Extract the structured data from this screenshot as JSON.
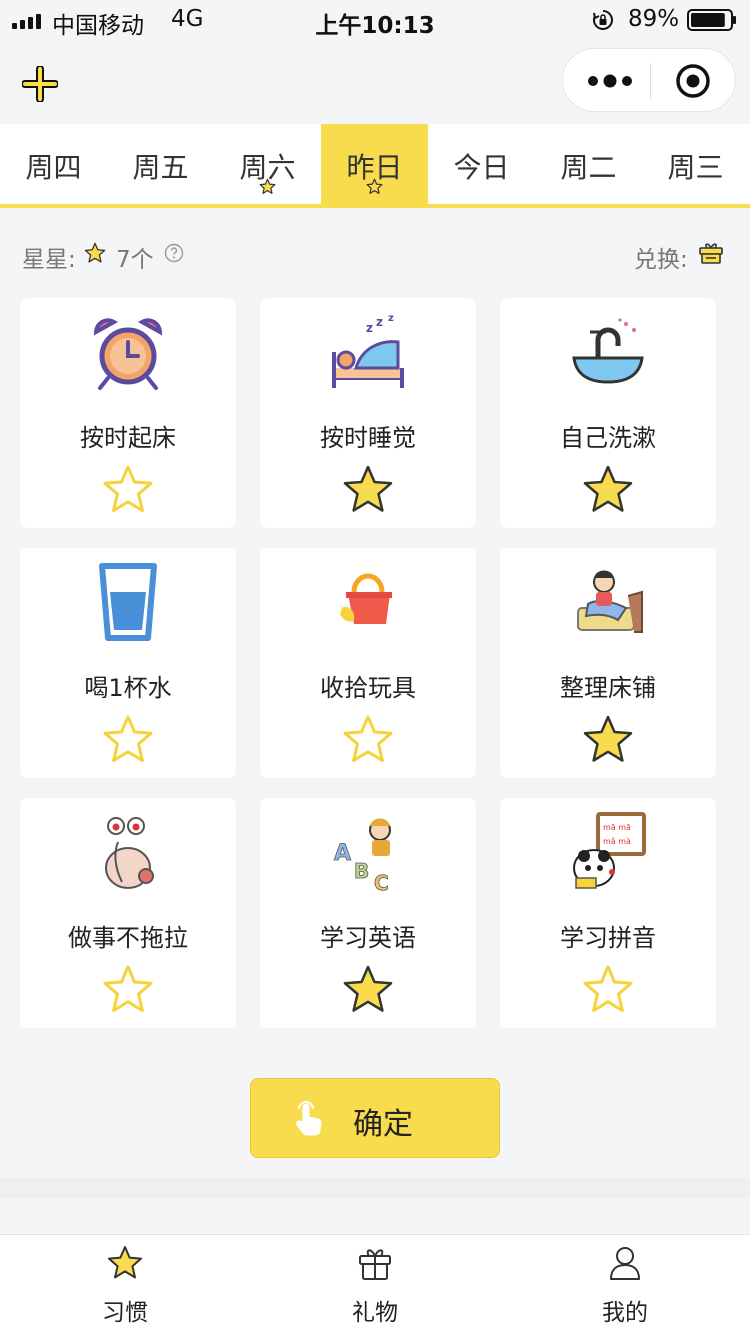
{
  "status_bar": {
    "carrier": "中国移动",
    "network": "4G",
    "time": "上午10:13",
    "battery": "89%",
    "battery_level": 0.89
  },
  "header": {
    "plus_icon": "plus-icon",
    "capsule_icons": [
      "more-icon",
      "target-icon"
    ]
  },
  "tabs": [
    {
      "label": "周四",
      "star": false,
      "active": false
    },
    {
      "label": "周五",
      "star": false,
      "active": false
    },
    {
      "label": "周六",
      "star": true,
      "active": false
    },
    {
      "label": "昨日",
      "star": true,
      "active": true
    },
    {
      "label": "今日",
      "star": false,
      "active": false
    },
    {
      "label": "周二",
      "star": false,
      "active": false
    },
    {
      "label": "周三",
      "star": false,
      "active": false
    }
  ],
  "summary": {
    "stars_label": "星星:",
    "stars_count": "7个",
    "exchange_label": "兑换:"
  },
  "habits": [
    {
      "label": "按时起床",
      "icon": "alarm-clock-icon",
      "starred": false
    },
    {
      "label": "按时睡觉",
      "icon": "sleeping-bed-icon",
      "starred": true
    },
    {
      "label": "自己洗漱",
      "icon": "washbasin-icon",
      "starred": true
    },
    {
      "label": "喝1杯水",
      "icon": "water-glass-icon",
      "starred": false
    },
    {
      "label": "收拾玩具",
      "icon": "toy-bucket-icon",
      "starred": false
    },
    {
      "label": "整理床铺",
      "icon": "making-bed-icon",
      "starred": true
    },
    {
      "label": "做事不拖拉",
      "icon": "snail-icon",
      "starred": false
    },
    {
      "label": "学习英语",
      "icon": "abc-boy-icon",
      "starred": true
    },
    {
      "label": "学习拼音",
      "icon": "pinyin-board-icon",
      "starred": false
    }
  ],
  "confirm": {
    "label": "确定",
    "icon": "hand-tap-icon"
  },
  "nav": [
    {
      "label": "习惯",
      "icon": "star-icon"
    },
    {
      "label": "礼物",
      "icon": "gift-icon"
    },
    {
      "label": "我的",
      "icon": "user-icon"
    }
  ],
  "colors": {
    "accent": "#f8dc4d",
    "background": "#f4f5f7",
    "star_outline": "#f5d33a"
  }
}
